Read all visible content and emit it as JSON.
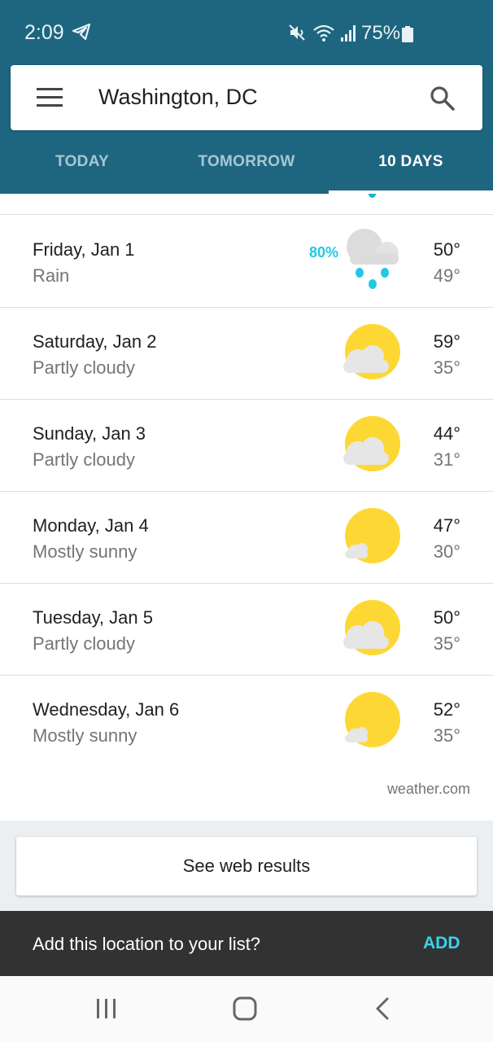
{
  "status_bar": {
    "time": "2:09",
    "battery": "75%",
    "icons": [
      "telegram-icon",
      "mute-icon",
      "wifi-icon",
      "signal-icon",
      "battery-icon"
    ]
  },
  "search": {
    "location": "Washington, DC"
  },
  "tabs": [
    {
      "label": "TODAY",
      "active": false
    },
    {
      "label": "TOMORROW",
      "active": false
    },
    {
      "label": "10 DAYS",
      "active": true
    }
  ],
  "forecast": [
    {
      "date": "Friday, Jan 1",
      "condition": "Rain",
      "precip": "80%",
      "high": "50°",
      "low": "49°",
      "icon": "rain-icon"
    },
    {
      "date": "Saturday, Jan 2",
      "condition": "Partly cloudy",
      "precip": "",
      "high": "59°",
      "low": "35°",
      "icon": "partly-cloudy-icon"
    },
    {
      "date": "Sunday, Jan 3",
      "condition": "Partly cloudy",
      "precip": "",
      "high": "44°",
      "low": "31°",
      "icon": "partly-cloudy-icon"
    },
    {
      "date": "Monday, Jan 4",
      "condition": "Mostly sunny",
      "precip": "",
      "high": "47°",
      "low": "30°",
      "icon": "mostly-sunny-icon"
    },
    {
      "date": "Tuesday, Jan 5",
      "condition": "Partly cloudy",
      "precip": "",
      "high": "50°",
      "low": "35°",
      "icon": "partly-cloudy-icon"
    },
    {
      "date": "Wednesday, Jan 6",
      "condition": "Mostly sunny",
      "precip": "",
      "high": "52°",
      "low": "35°",
      "icon": "mostly-sunny-icon"
    }
  ],
  "source": "weather.com",
  "web_results_label": "See web results",
  "snackbar": {
    "message": "Add this location to your list?",
    "action": "ADD"
  },
  "colors": {
    "header": "#1e6680",
    "accent": "#22c7e4",
    "sun": "#fdd835",
    "snackbar": "#323232"
  }
}
